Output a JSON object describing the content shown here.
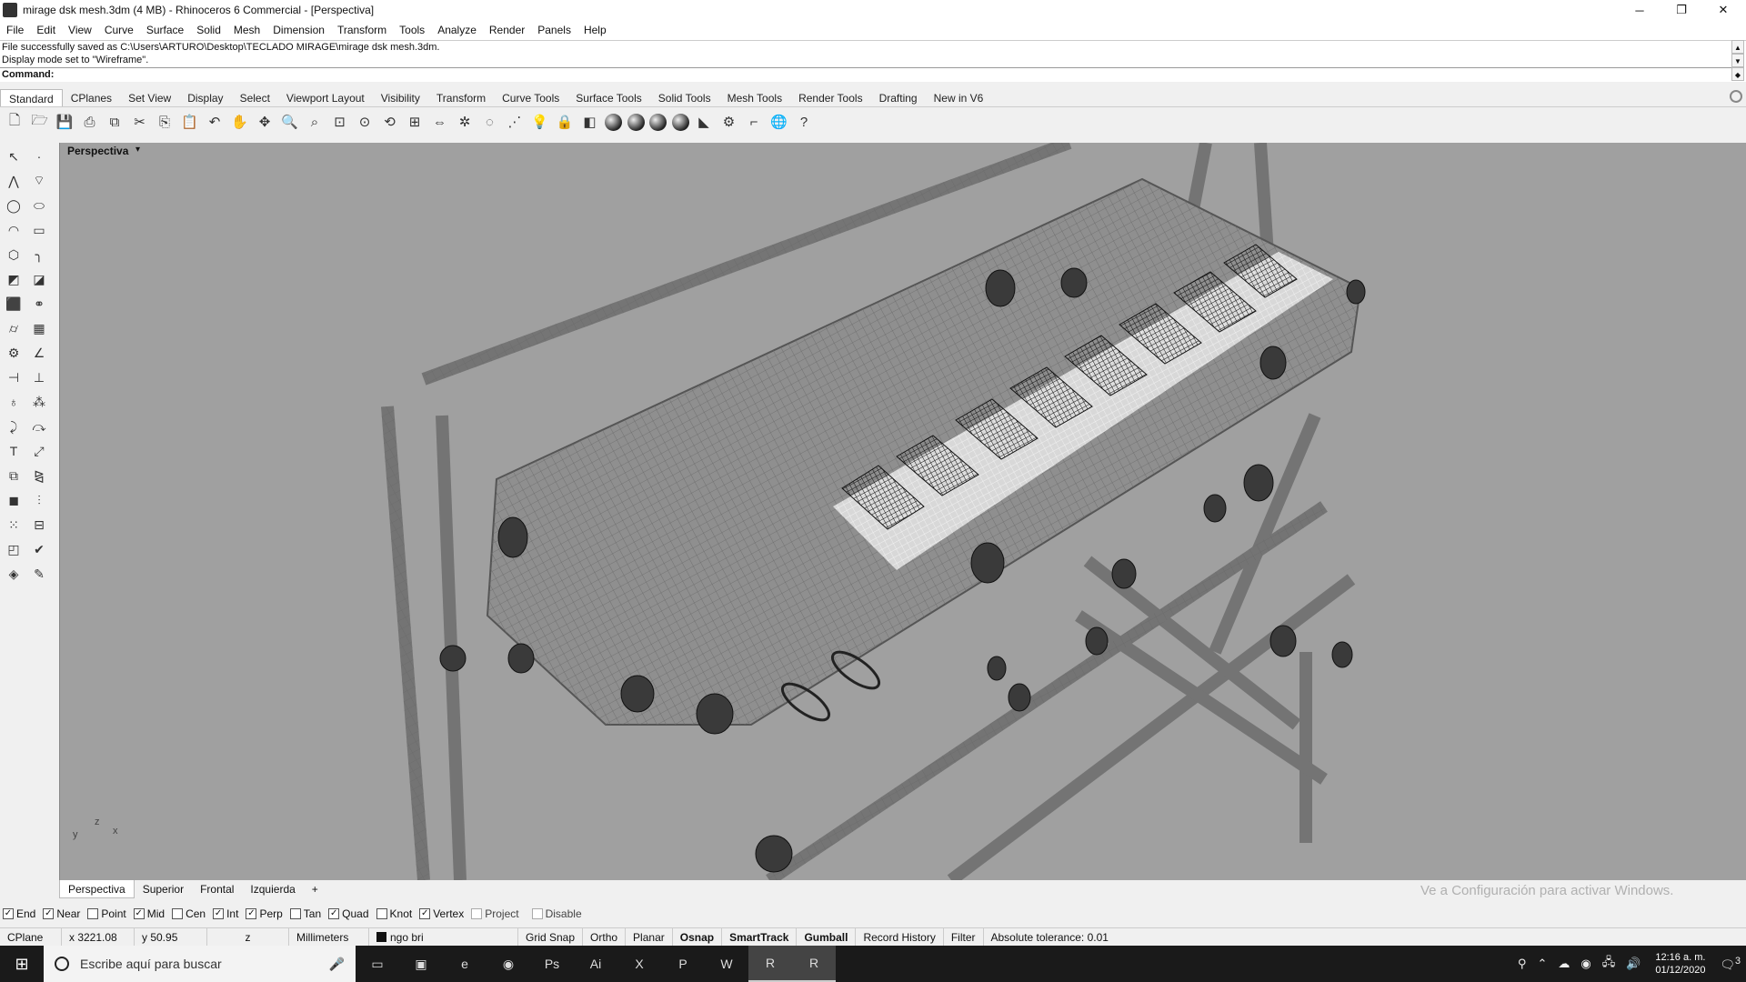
{
  "window": {
    "title": "mirage dsk mesh.3dm (4 MB) - Rhinoceros 6 Commercial - [Perspectiva]",
    "controls": [
      "─",
      "❐",
      "✕"
    ]
  },
  "menu": [
    "File",
    "Edit",
    "View",
    "Curve",
    "Surface",
    "Solid",
    "Mesh",
    "Dimension",
    "Transform",
    "Tools",
    "Analyze",
    "Render",
    "Panels",
    "Help"
  ],
  "history": {
    "line1": "File successfully saved as C:\\Users\\ARTURO\\Desktop\\TECLADO MIRAGE\\mirage dsk mesh.3dm.",
    "line2": "Display mode set to \"Wireframe\".",
    "command_label": "Command:"
  },
  "toolbar_tabs": [
    "Standard",
    "CPlanes",
    "Set View",
    "Display",
    "Select",
    "Viewport Layout",
    "Visibility",
    "Transform",
    "Curve Tools",
    "Surface Tools",
    "Solid Tools",
    "Mesh Tools",
    "Render Tools",
    "Drafting",
    "New in V6"
  ],
  "viewport": {
    "title": "Perspectiva",
    "axis_label_y": "y",
    "axis_label_z": "z",
    "axis_label_x": "x",
    "watermark": "Ve a Configuración para activar Windows."
  },
  "viewport_tabs": [
    "Perspectiva",
    "Superior",
    "Frontal",
    "Izquierda",
    "+"
  ],
  "osnaps": [
    {
      "label": "End",
      "checked": true
    },
    {
      "label": "Near",
      "checked": true
    },
    {
      "label": "Point",
      "checked": false
    },
    {
      "label": "Mid",
      "checked": true
    },
    {
      "label": "Cen",
      "checked": false
    },
    {
      "label": "Int",
      "checked": true
    },
    {
      "label": "Perp",
      "checked": true
    },
    {
      "label": "Tan",
      "checked": false
    },
    {
      "label": "Quad",
      "checked": true
    },
    {
      "label": "Knot",
      "checked": false
    },
    {
      "label": "Vertex",
      "checked": true
    },
    {
      "label": "Project",
      "checked": false
    },
    {
      "label": "Disable",
      "checked": false
    }
  ],
  "status": {
    "cplane": "CPlane",
    "x": "x 3221.08",
    "y": "y 50.95",
    "z": "z",
    "units": "Millimeters",
    "layer": "ngo bri",
    "grid_snap": "Grid Snap",
    "ortho": "Ortho",
    "planar": "Planar",
    "osnap": "Osnap",
    "smarttrack": "SmartTrack",
    "gumball": "Gumball",
    "record_history": "Record History",
    "filter": "Filter",
    "tolerance": "Absolute tolerance: 0.01"
  },
  "taskbar": {
    "search_placeholder": "Escribe aquí para buscar",
    "apps": [
      "▭",
      "▣",
      "e",
      "◉",
      "Ps",
      "Ai",
      "X",
      "P",
      "W",
      "R",
      "R"
    ],
    "time": "12:16 a. m.",
    "date": "01/12/2020",
    "notif_count": "3"
  }
}
